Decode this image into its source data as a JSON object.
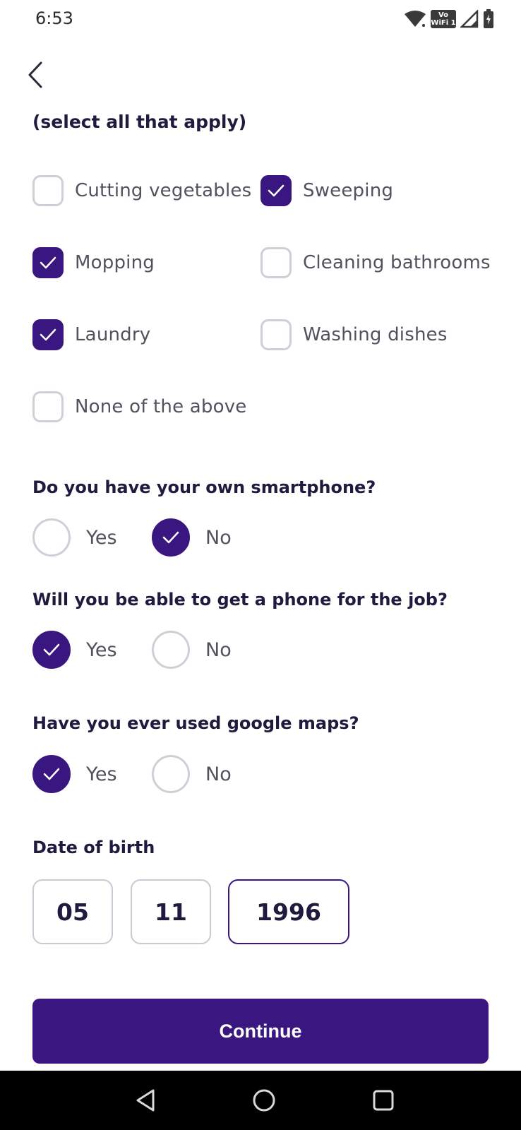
{
  "status_bar": {
    "time": "6:53",
    "vowifi_top": "Vo",
    "vowifi_bottom": "WiFi 1",
    "icons": [
      "wifi-icon",
      "vowifi-icon",
      "signal-icon",
      "battery-icon"
    ]
  },
  "header": {
    "back_icon": "chevron-left-icon"
  },
  "tasks": {
    "hint": "(select all that apply)",
    "options": [
      {
        "label": "Cutting vegetables",
        "checked": false
      },
      {
        "label": "Sweeping",
        "checked": true
      },
      {
        "label": "Mopping",
        "checked": true
      },
      {
        "label": "Cleaning bathrooms",
        "checked": false
      },
      {
        "label": "Laundry",
        "checked": true
      },
      {
        "label": "Washing dishes",
        "checked": false
      },
      {
        "label": "None of the above",
        "checked": false
      }
    ]
  },
  "questions": [
    {
      "text": "Do you have your own smartphone?",
      "yes_label": "Yes",
      "no_label": "No",
      "selected": "No"
    },
    {
      "text": "Will you be able to get a phone for the job?",
      "yes_label": "Yes",
      "no_label": "No",
      "selected": "Yes"
    },
    {
      "text": "Have you ever used google maps?",
      "yes_label": "Yes",
      "no_label": "No",
      "selected": "Yes"
    }
  ],
  "dob": {
    "label": "Date of birth",
    "day": "05",
    "month": "11",
    "year": "1996"
  },
  "continue_label": "Continue",
  "colors": {
    "accent": "#3a1780",
    "text_dark": "#1f1b3e",
    "text_muted": "#52525e",
    "border": "#cfcfd8",
    "nav_bg": "#000000"
  },
  "nav_bar": {
    "icons": [
      "back-triangle-icon",
      "home-circle-icon",
      "recents-square-icon"
    ]
  }
}
